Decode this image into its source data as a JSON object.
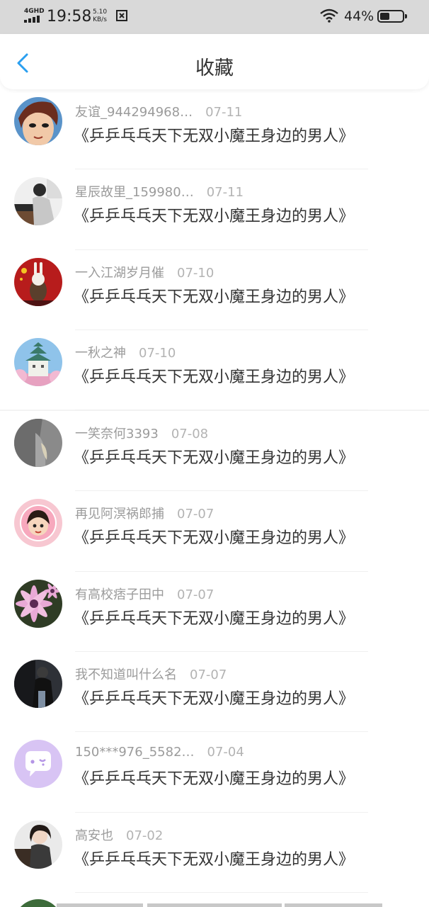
{
  "status_bar": {
    "network": "4GHD",
    "time": "19:58",
    "speed_value": "5.10",
    "speed_unit": "KB/s",
    "battery": "44%",
    "battery_level": 0.44
  },
  "header": {
    "title": "收藏",
    "back_icon": "chevron-left-icon",
    "accent": "#2a9ff0"
  },
  "favorites": [
    {
      "user": "友谊_944294968…",
      "date": "07-11",
      "title": "《乒乒乓乓天下无双小魔王身边的男人》",
      "avatar": "cartoon-face"
    },
    {
      "user": "星辰故里_159980…",
      "date": "07-11",
      "title": "《乒乒乓乓天下无双小魔王身边的男人》",
      "avatar": "piano-player"
    },
    {
      "user": "一入江湖岁月催",
      "date": "07-10",
      "title": "《乒乒乓乓天下无双小魔王身边的男人》",
      "avatar": "rabbit-flag"
    },
    {
      "user": "一秋之神",
      "date": "07-10",
      "title": "《乒乒乓乓天下无双小魔王身边的男人》",
      "avatar": "castle"
    },
    {
      "user": "一笑奈何3393",
      "date": "07-08",
      "title": "《乒乒乓乓天下无双小魔王身边的男人》",
      "avatar": "gray-fabric"
    },
    {
      "user": "再见阿溟祸郎捕",
      "date": "07-07",
      "title": "《乒乒乓乓天下无双小魔王身边的男人》",
      "avatar": "pink-girl"
    },
    {
      "user": "有高校痞子田中",
      "date": "07-07",
      "title": "《乒乒乓乓天下无双小魔王身边的男人》",
      "avatar": "flower"
    },
    {
      "user": "我不知道叫什么名",
      "date": "07-07",
      "title": "《乒乒乓乓天下无双小魔王身边的男人》",
      "avatar": "dark-person"
    },
    {
      "user": "150***976_5582…",
      "date": "07-04",
      "title": "《乒乒乓乓天下无双小魔王身边的男人》",
      "avatar": "default-chat"
    },
    {
      "user": "高安也",
      "date": "07-02",
      "title": "《乒乒乓乓天下无双小魔王身边的男人》",
      "avatar": "girl-photo"
    }
  ]
}
